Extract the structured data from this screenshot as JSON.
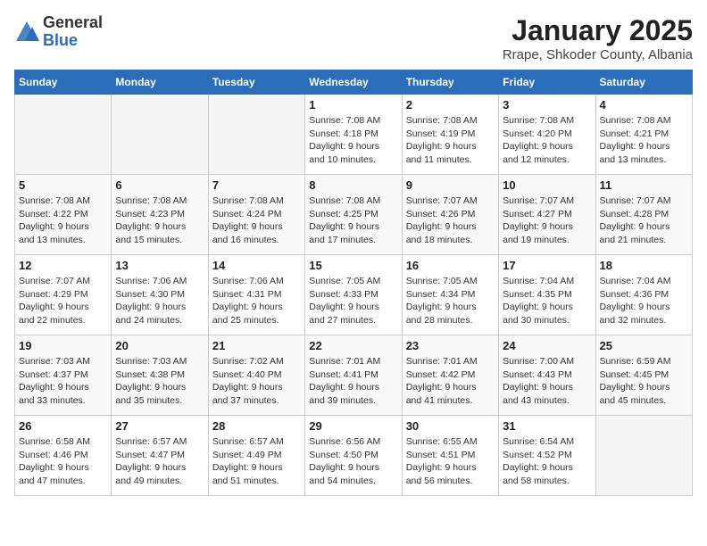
{
  "logo": {
    "general": "General",
    "blue": "Blue"
  },
  "title": "January 2025",
  "subtitle": "Rrape, Shkoder County, Albania",
  "days_header": [
    "Sunday",
    "Monday",
    "Tuesday",
    "Wednesday",
    "Thursday",
    "Friday",
    "Saturday"
  ],
  "weeks": [
    [
      {
        "num": "",
        "info": ""
      },
      {
        "num": "",
        "info": ""
      },
      {
        "num": "",
        "info": ""
      },
      {
        "num": "1",
        "info": "Sunrise: 7:08 AM\nSunset: 4:18 PM\nDaylight: 9 hours\nand 10 minutes."
      },
      {
        "num": "2",
        "info": "Sunrise: 7:08 AM\nSunset: 4:19 PM\nDaylight: 9 hours\nand 11 minutes."
      },
      {
        "num": "3",
        "info": "Sunrise: 7:08 AM\nSunset: 4:20 PM\nDaylight: 9 hours\nand 12 minutes."
      },
      {
        "num": "4",
        "info": "Sunrise: 7:08 AM\nSunset: 4:21 PM\nDaylight: 9 hours\nand 13 minutes."
      }
    ],
    [
      {
        "num": "5",
        "info": "Sunrise: 7:08 AM\nSunset: 4:22 PM\nDaylight: 9 hours\nand 13 minutes."
      },
      {
        "num": "6",
        "info": "Sunrise: 7:08 AM\nSunset: 4:23 PM\nDaylight: 9 hours\nand 15 minutes."
      },
      {
        "num": "7",
        "info": "Sunrise: 7:08 AM\nSunset: 4:24 PM\nDaylight: 9 hours\nand 16 minutes."
      },
      {
        "num": "8",
        "info": "Sunrise: 7:08 AM\nSunset: 4:25 PM\nDaylight: 9 hours\nand 17 minutes."
      },
      {
        "num": "9",
        "info": "Sunrise: 7:07 AM\nSunset: 4:26 PM\nDaylight: 9 hours\nand 18 minutes."
      },
      {
        "num": "10",
        "info": "Sunrise: 7:07 AM\nSunset: 4:27 PM\nDaylight: 9 hours\nand 19 minutes."
      },
      {
        "num": "11",
        "info": "Sunrise: 7:07 AM\nSunset: 4:28 PM\nDaylight: 9 hours\nand 21 minutes."
      }
    ],
    [
      {
        "num": "12",
        "info": "Sunrise: 7:07 AM\nSunset: 4:29 PM\nDaylight: 9 hours\nand 22 minutes."
      },
      {
        "num": "13",
        "info": "Sunrise: 7:06 AM\nSunset: 4:30 PM\nDaylight: 9 hours\nand 24 minutes."
      },
      {
        "num": "14",
        "info": "Sunrise: 7:06 AM\nSunset: 4:31 PM\nDaylight: 9 hours\nand 25 minutes."
      },
      {
        "num": "15",
        "info": "Sunrise: 7:05 AM\nSunset: 4:33 PM\nDaylight: 9 hours\nand 27 minutes."
      },
      {
        "num": "16",
        "info": "Sunrise: 7:05 AM\nSunset: 4:34 PM\nDaylight: 9 hours\nand 28 minutes."
      },
      {
        "num": "17",
        "info": "Sunrise: 7:04 AM\nSunset: 4:35 PM\nDaylight: 9 hours\nand 30 minutes."
      },
      {
        "num": "18",
        "info": "Sunrise: 7:04 AM\nSunset: 4:36 PM\nDaylight: 9 hours\nand 32 minutes."
      }
    ],
    [
      {
        "num": "19",
        "info": "Sunrise: 7:03 AM\nSunset: 4:37 PM\nDaylight: 9 hours\nand 33 minutes."
      },
      {
        "num": "20",
        "info": "Sunrise: 7:03 AM\nSunset: 4:38 PM\nDaylight: 9 hours\nand 35 minutes."
      },
      {
        "num": "21",
        "info": "Sunrise: 7:02 AM\nSunset: 4:40 PM\nDaylight: 9 hours\nand 37 minutes."
      },
      {
        "num": "22",
        "info": "Sunrise: 7:01 AM\nSunset: 4:41 PM\nDaylight: 9 hours\nand 39 minutes."
      },
      {
        "num": "23",
        "info": "Sunrise: 7:01 AM\nSunset: 4:42 PM\nDaylight: 9 hours\nand 41 minutes."
      },
      {
        "num": "24",
        "info": "Sunrise: 7:00 AM\nSunset: 4:43 PM\nDaylight: 9 hours\nand 43 minutes."
      },
      {
        "num": "25",
        "info": "Sunrise: 6:59 AM\nSunset: 4:45 PM\nDaylight: 9 hours\nand 45 minutes."
      }
    ],
    [
      {
        "num": "26",
        "info": "Sunrise: 6:58 AM\nSunset: 4:46 PM\nDaylight: 9 hours\nand 47 minutes."
      },
      {
        "num": "27",
        "info": "Sunrise: 6:57 AM\nSunset: 4:47 PM\nDaylight: 9 hours\nand 49 minutes."
      },
      {
        "num": "28",
        "info": "Sunrise: 6:57 AM\nSunset: 4:49 PM\nDaylight: 9 hours\nand 51 minutes."
      },
      {
        "num": "29",
        "info": "Sunrise: 6:56 AM\nSunset: 4:50 PM\nDaylight: 9 hours\nand 54 minutes."
      },
      {
        "num": "30",
        "info": "Sunrise: 6:55 AM\nSunset: 4:51 PM\nDaylight: 9 hours\nand 56 minutes."
      },
      {
        "num": "31",
        "info": "Sunrise: 6:54 AM\nSunset: 4:52 PM\nDaylight: 9 hours\nand 58 minutes."
      },
      {
        "num": "",
        "info": ""
      }
    ]
  ]
}
